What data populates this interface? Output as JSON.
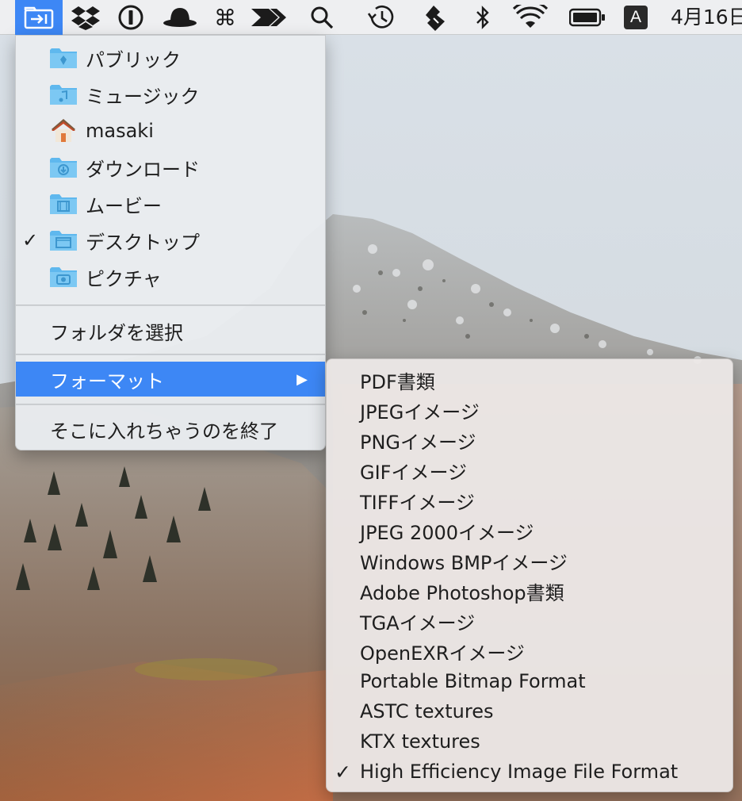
{
  "menubar": {
    "clock": "4月16日",
    "input_method_letter": "A",
    "icons": [
      "dropin-folder-icon",
      "dropbox-icon",
      "1password-icon",
      "bowler-hat-icon",
      "command-icon",
      "arrow-app-icon",
      "spotlight-search-icon",
      "time-machine-icon",
      "hand-icon",
      "bluetooth-icon",
      "wifi-icon",
      "battery-icon",
      "input-source-icon"
    ]
  },
  "main_menu": {
    "folders": [
      {
        "label": "パブリック",
        "icon": "public-folder-icon",
        "checked": false
      },
      {
        "label": "ミュージック",
        "icon": "music-folder-icon",
        "checked": false
      },
      {
        "label": "masaki",
        "icon": "home-icon",
        "checked": false
      },
      {
        "label": "ダウンロード",
        "icon": "downloads-folder-icon",
        "checked": false
      },
      {
        "label": "ムービー",
        "icon": "movies-folder-icon",
        "checked": false
      },
      {
        "label": "デスクトップ",
        "icon": "desktop-folder-icon",
        "checked": true
      },
      {
        "label": "ピクチャ",
        "icon": "pictures-folder-icon",
        "checked": false
      }
    ],
    "choose_folder": "フォルダを選択",
    "format": "フォーマット",
    "quit": "そこに入れちゃうのを終了",
    "checkmark": "✓",
    "arrow": "▶"
  },
  "format_menu": {
    "checkmark": "✓",
    "items": [
      {
        "label": "PDF書類",
        "checked": false
      },
      {
        "label": "JPEGイメージ",
        "checked": false
      },
      {
        "label": "PNGイメージ",
        "checked": false
      },
      {
        "label": "GIFイメージ",
        "checked": false
      },
      {
        "label": "TIFFイメージ",
        "checked": false
      },
      {
        "label": "JPEG 2000イメージ",
        "checked": false
      },
      {
        "label": "Windows BMPイメージ",
        "checked": false
      },
      {
        "label": "Adobe Photoshop書類",
        "checked": false
      },
      {
        "label": "TGAイメージ",
        "checked": false
      },
      {
        "label": "OpenEXRイメージ",
        "checked": false
      },
      {
        "label": "Portable Bitmap Format",
        "checked": false
      },
      {
        "label": "ASTC textures",
        "checked": false
      },
      {
        "label": "KTX textures",
        "checked": false
      },
      {
        "label": "High Efficiency Image File Format",
        "checked": true
      }
    ]
  },
  "colors": {
    "accent": "#3d87f5",
    "folder": "#5fb8ee"
  }
}
